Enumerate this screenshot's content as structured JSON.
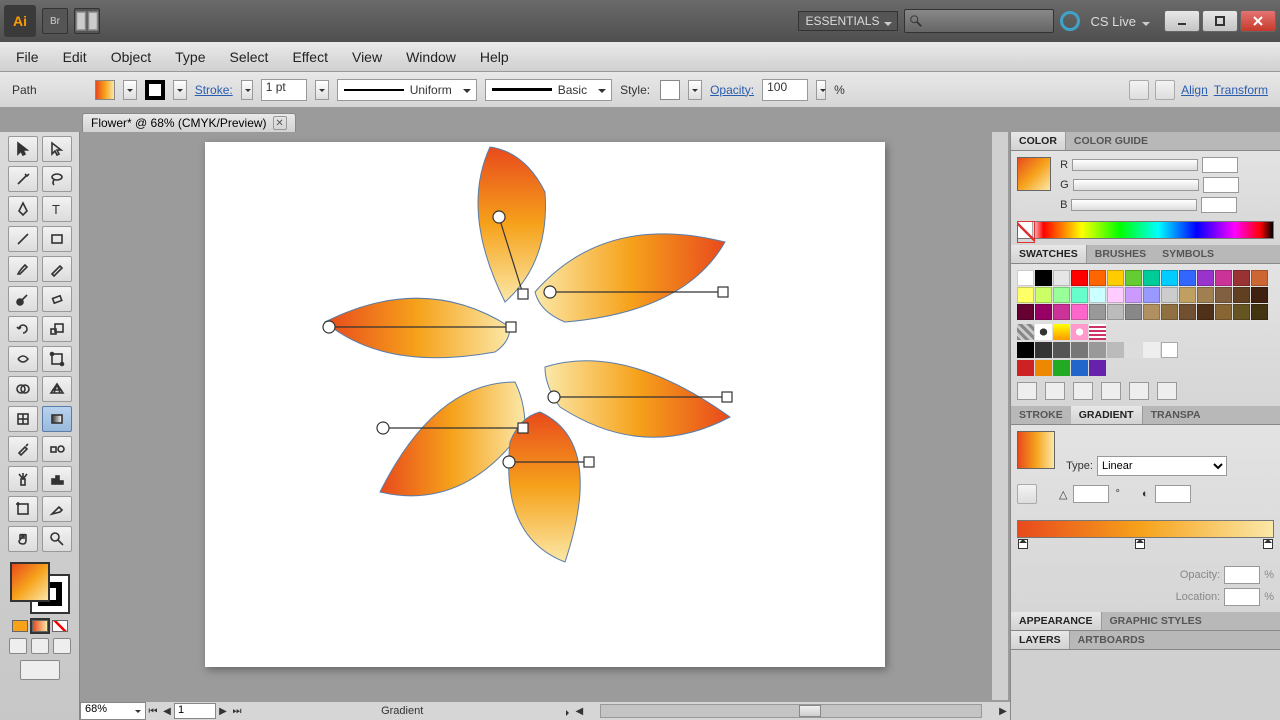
{
  "app": {
    "logo": "Ai",
    "bridge": "Br"
  },
  "workspace": "ESSENTIALS",
  "cslive": "CS Live",
  "menus": [
    "File",
    "Edit",
    "Object",
    "Type",
    "Select",
    "Effect",
    "View",
    "Window",
    "Help"
  ],
  "control": {
    "selection": "Path",
    "stroke_label": "Stroke:",
    "stroke_pt": "1 pt",
    "variable_profile": "Uniform",
    "brush_def": "Basic",
    "style_label": "Style:",
    "opacity_label": "Opacity:",
    "opacity_val": "100",
    "opacity_unit": "%",
    "align": "Align",
    "transform": "Transform"
  },
  "document": {
    "tab_title": "Flower* @ 68% (CMYK/Preview)"
  },
  "status": {
    "zoom": "68%",
    "page": "1",
    "hint": "Gradient"
  },
  "panels": {
    "color": {
      "tabs": [
        "COLOR",
        "COLOR GUIDE"
      ],
      "labels": [
        "R",
        "G",
        "B"
      ]
    },
    "swatches": {
      "tabs": [
        "SWATCHES",
        "BRUSHES",
        "SYMBOLS"
      ]
    },
    "gradient": {
      "tabs": [
        "STROKE",
        "GRADIENT",
        "TRANSPA"
      ],
      "type_label": "Type:",
      "type_value": "Linear",
      "opacity_lbl": "Opacity:",
      "location_lbl": "Location:",
      "unit": "%"
    },
    "appearance": {
      "tabs": [
        "APPEARANCE",
        "GRAPHIC STYLES"
      ]
    },
    "layers": {
      "tabs": [
        "LAYERS",
        "ARTBOARDS"
      ]
    }
  },
  "colors": {
    "fill_gradient_start": "#e84a1c",
    "fill_gradient_mid": "#f6a21b",
    "fill_gradient_end": "#fbe8a8",
    "stroke": "#000000"
  },
  "swatch_rows": [
    [
      "#ffffff",
      "#000000",
      "#e6e6e6",
      "#ff0000",
      "#ff6600",
      "#ffcc00",
      "#66cc33",
      "#00cc99",
      "#00ccff",
      "#3366ff",
      "#9933cc",
      "#cc3399",
      "#993333",
      "#cc6633"
    ],
    [
      "#ffff66",
      "#ccff66",
      "#99ff99",
      "#66ffcc",
      "#ccffff",
      "#ffccff",
      "#cc99ff",
      "#9999ff",
      "#cccccc",
      "#c0a060",
      "#a08050",
      "#806040",
      "#604020",
      "#402010"
    ],
    [
      "#660033",
      "#990066",
      "#cc3399",
      "#ff66cc",
      "#999999",
      "#bbbbbb",
      "#888888",
      "#b09060",
      "#907040",
      "#705030",
      "#503018",
      "#886633",
      "#665522",
      "#443311"
    ]
  ]
}
